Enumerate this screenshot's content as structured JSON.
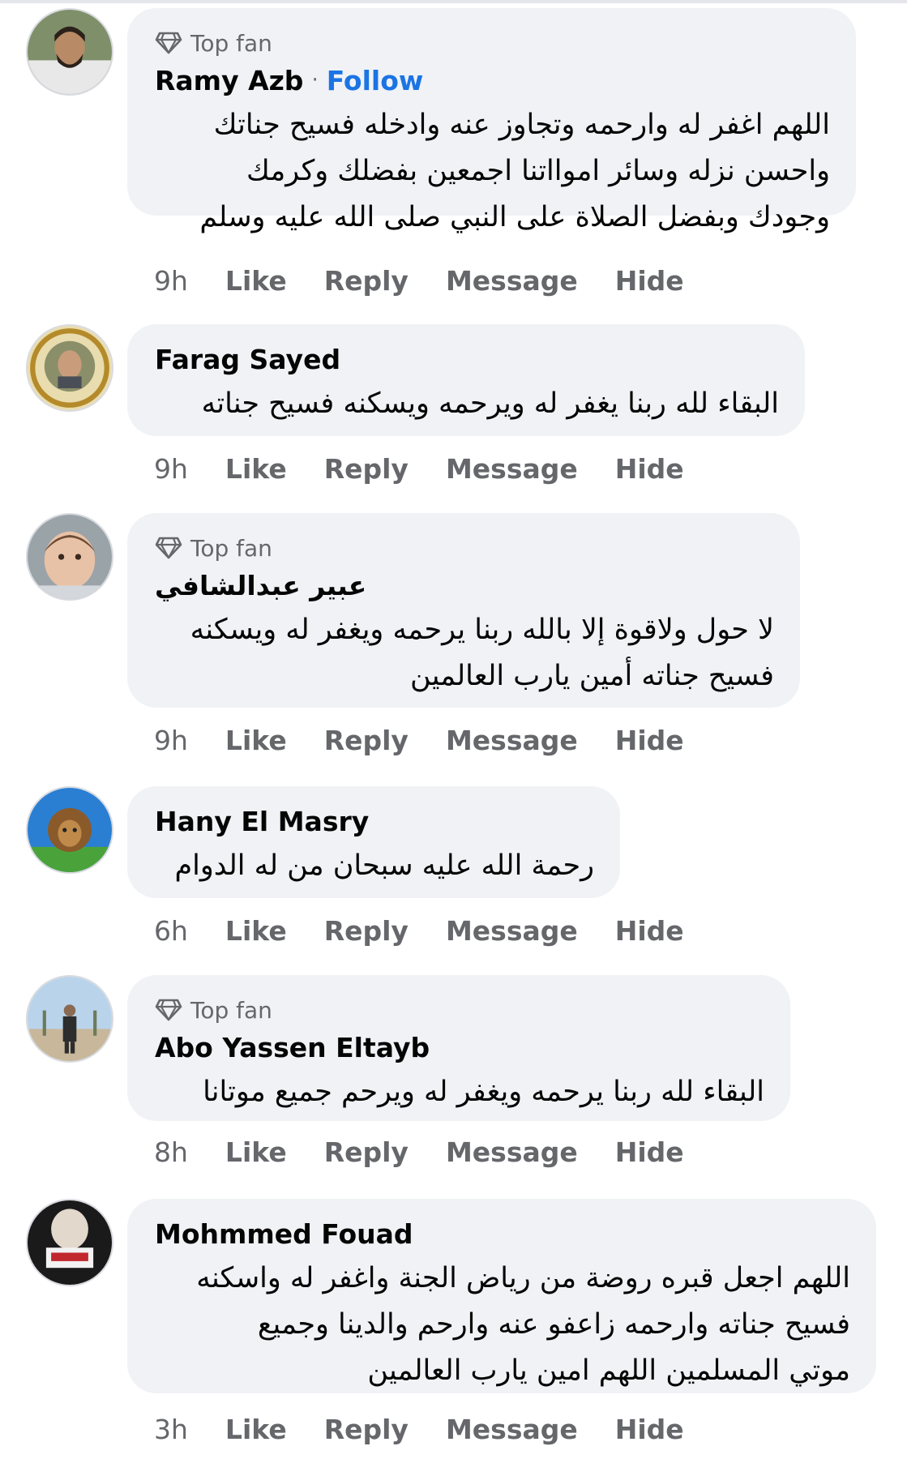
{
  "comments": [
    {
      "badge": "Top fan",
      "name": "Ramy Azb",
      "separator": "·",
      "follow": "Follow",
      "lines": [
        "اللهم اغفر له وارحمه وتجاوز عنه وادخله فسيح جناتك",
        "واحسن نزله وسائر اموااتنا اجمعين بفضلك وكرمك",
        "وجودك وبفضل الصلاة على النبي صلى الله عليه وسلم"
      ],
      "time": "9h",
      "actions": [
        "Like",
        "Reply",
        "Message",
        "Hide"
      ]
    },
    {
      "name": "Farag Sayed",
      "lines": [
        "البقاء لله ربنا يغفر له ويرحمه ويسكنه فسيح جناته"
      ],
      "time": "9h",
      "actions": [
        "Like",
        "Reply",
        "Message",
        "Hide"
      ]
    },
    {
      "badge": "Top fan",
      "name": "عبير عبدالشافي",
      "lines": [
        "لا حول ولاقوة إلا بالله ربنا يرحمه ويغفر له ويسكنه",
        "فسيح جناته أمين يارب العالمين"
      ],
      "time": "9h",
      "actions": [
        "Like",
        "Reply",
        "Message",
        "Hide"
      ]
    },
    {
      "name": "Hany El Masry",
      "lines": [
        "رحمة الله عليه سبحان من له الدوام"
      ],
      "time": "6h",
      "actions": [
        "Like",
        "Reply",
        "Message",
        "Hide"
      ]
    },
    {
      "badge": "Top fan",
      "name": "Abo Yassen Eltayb",
      "lines": [
        "البقاء لله ربنا يرحمه ويغفر له ويرحم جميع موتانا"
      ],
      "time": "8h",
      "actions": [
        "Like",
        "Reply",
        "Message",
        "Hide"
      ]
    },
    {
      "name": "Mohmmed Fouad",
      "lines": [
        "اللهم اجعل قبره روضة من رياض الجنة واغفر له واسكنه",
        "فسيح جناته وارحمه زاعفو عنه وارحم والدينا وجميع",
        "موتي المسلمين اللهم امين يارب العالمين"
      ],
      "time": "3h",
      "actions": [
        "Like",
        "Reply",
        "Message",
        "Hide"
      ]
    }
  ],
  "colors": {
    "bubble": "#f0f2f5",
    "link": "#1b74e4",
    "meta": "#65676b",
    "text": "#050505"
  }
}
